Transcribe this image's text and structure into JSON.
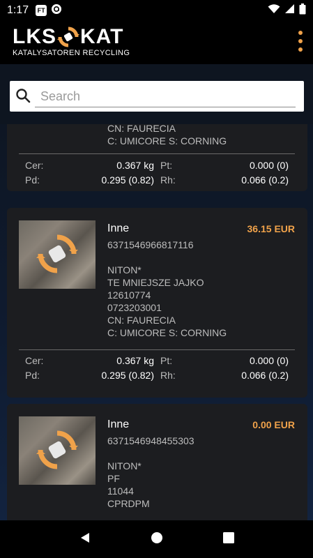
{
  "status_bar": {
    "time": "1:17",
    "badge_label": "FT"
  },
  "app": {
    "logo_left": "LKS",
    "logo_right": "KAT",
    "logo_subtitle": "KATALYSATOREN RECYCLING",
    "accent_color": "#f0a24a"
  },
  "search": {
    "placeholder": "Search",
    "value": ""
  },
  "cards": [
    {
      "lines": [
        "CN: FAURECIA",
        "C: UMICORE  S: CORNING"
      ],
      "cer": "0.367 kg",
      "pt": "0.000 (0)",
      "pd": "0.295 (0.82)",
      "rh": "0.066 (0.2)"
    },
    {
      "name": "Inne",
      "price": "36.15 EUR",
      "code": "6371546966817116",
      "lines": [
        "NITON*",
        "TE MNIEJSZE JAJKO",
        "12610774",
        "0723203001",
        "CN: FAURECIA",
        "C: UMICORE  S: CORNING"
      ],
      "cer": "0.367 kg",
      "pt": "0.000 (0)",
      "pd": "0.295 (0.82)",
      "rh": "0.066 (0.2)"
    },
    {
      "name": "Inne",
      "price": "0.00 EUR",
      "code": "6371546948455303",
      "lines": [
        "NITON*",
        "PF",
        "11044",
        "CPRDPM"
      ]
    }
  ],
  "labels": {
    "cer": "Cer:",
    "pt": "Pt:",
    "pd": "Pd:",
    "rh": "Rh:"
  },
  "icons": {
    "status": [
      "ft-app-icon",
      "at-sign-icon",
      "wifi-icon",
      "signal-icon",
      "battery-icon"
    ],
    "nav": [
      "back-icon",
      "home-icon",
      "recents-icon"
    ]
  }
}
